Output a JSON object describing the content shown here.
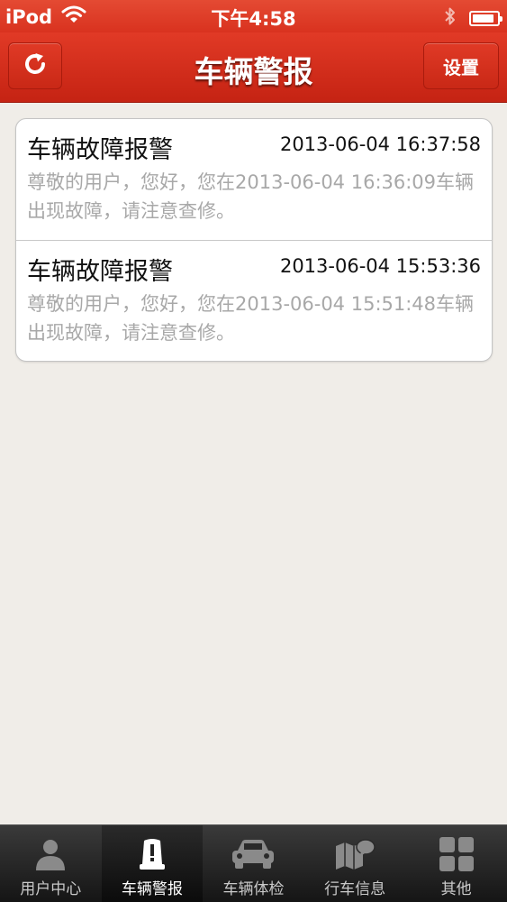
{
  "status_bar": {
    "carrier": "iPod",
    "time": "下午4:58",
    "battery_level": 0.9
  },
  "nav_bar": {
    "title": "车辆警报",
    "settings_label": "设置",
    "refresh_icon": "refresh-icon"
  },
  "alerts": [
    {
      "title": "车辆故障报警",
      "time": "2013-06-04 16:37:58",
      "message": "尊敬的用户，您好，您在2013-06-04 16:36:09车辆出现故障，请注意查修。"
    },
    {
      "title": "车辆故障报警",
      "time": "2013-06-04 15:53:36",
      "message": "尊敬的用户，您好，您在2013-06-04 15:51:48车辆出现故障，请注意查修。"
    }
  ],
  "tabs": [
    {
      "label": "用户中心",
      "icon": "user-icon",
      "active": false
    },
    {
      "label": "车辆警报",
      "icon": "alert-icon",
      "active": true
    },
    {
      "label": "车辆体检",
      "icon": "car-icon",
      "active": false
    },
    {
      "label": "行车信息",
      "icon": "map-chat-icon",
      "active": false
    },
    {
      "label": "其他",
      "icon": "grid-icon",
      "active": false
    }
  ],
  "colors": {
    "nav_red": "#d9321f",
    "background": "#f0ede8",
    "message_gray": "#a8a8a8"
  }
}
